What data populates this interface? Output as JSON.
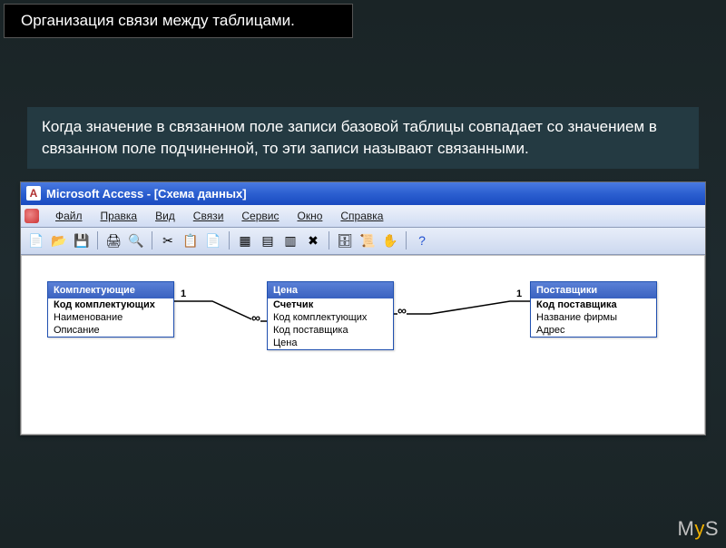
{
  "slide": {
    "title": "Организация связи между таблицами.",
    "paragraph": "Когда значение в связанном поле записи базовой таблицы совпадает со значением в связанном поле подчиненной, то эти записи называют связанными."
  },
  "app": {
    "title": "Microsoft Access - [Схема данных]",
    "menu": [
      "Файл",
      "Правка",
      "Вид",
      "Связи",
      "Сервис",
      "Окно",
      "Справка"
    ]
  },
  "tables": {
    "t1": {
      "name": "Комплектующие",
      "fields": [
        "Код комплектующих",
        "Наименование",
        "Описание"
      ]
    },
    "t2": {
      "name": "Цена",
      "fields": [
        "Счетчик",
        "Код комплектующих",
        "Код поставщика",
        "Цена"
      ]
    },
    "t3": {
      "name": "Поставщики",
      "fields": [
        "Код поставщика",
        "Название фирмы",
        "Адрес"
      ]
    }
  },
  "links": {
    "one": "1",
    "many": "∞"
  },
  "watermark": {
    "part1": "M",
    "part2": "y",
    "part3": "S"
  }
}
